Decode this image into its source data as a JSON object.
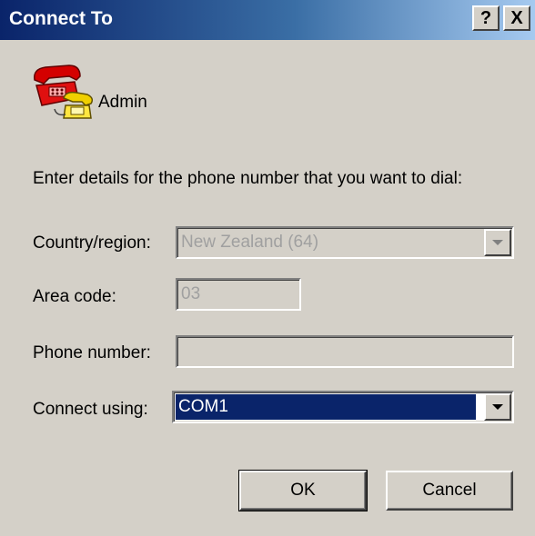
{
  "window": {
    "title": "Connect To",
    "help_button": "?",
    "close_button": "X"
  },
  "header": {
    "icon": "phone-icon",
    "connection_name": "Admin"
  },
  "prompt": "Enter details for the phone number that you want to dial:",
  "form": {
    "country_label": "Country/region:",
    "country_value": "New Zealand (64)",
    "country_enabled": false,
    "area_label": "Area code:",
    "area_value": "03",
    "area_enabled": false,
    "phone_label": "Phone number:",
    "phone_value": "",
    "phone_enabled": false,
    "connect_label": "Connect using:",
    "connect_value": "COM1",
    "connect_enabled": true
  },
  "buttons": {
    "ok": "OK",
    "cancel": "Cancel"
  },
  "colors": {
    "title_bar": "#0a246a",
    "face": "#d4d0c8",
    "selection": "#0a246a"
  }
}
